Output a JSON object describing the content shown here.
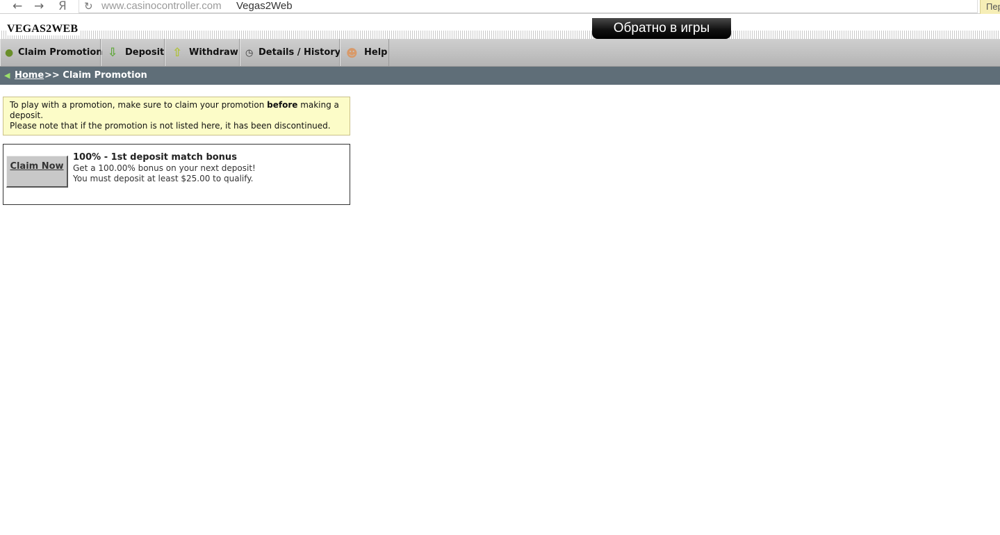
{
  "browser": {
    "back_icon": "←",
    "forward_icon": "→",
    "yandex_icon": "Я",
    "reload_icon": "↻",
    "url_domain": "www.casinocontroller.com",
    "url_title": "Vegas2Web",
    "translate_label": "Пер"
  },
  "header": {
    "logo": "VEGAS2WEB",
    "back_to_games": "Обратно в игры"
  },
  "menu": {
    "claim_promotion": "Claim Promotion",
    "deposit": "Deposit",
    "withdraw": "Withdraw",
    "details_history": "Details / History",
    "help": "Help",
    "icons": {
      "claim": "coin-icon",
      "deposit": "arrow-down-icon",
      "withdraw": "arrow-up-icon",
      "details": "clock-icon",
      "help": "person-icon"
    }
  },
  "breadcrumb": {
    "home": "Home",
    "current": ">> Claim Promotion"
  },
  "notice": {
    "line1_before": "To play with a promotion, make sure to claim your promotion ",
    "line1_bold": "before",
    "line1_after": " making a deposit.",
    "line2": "Please note that if the promotion is not listed here, it has been discontinued."
  },
  "promotion": {
    "claim_button": "Claim Now",
    "title": "100% - 1st deposit match bonus",
    "line1": "Get a 100.00% bonus on your next deposit!",
    "line2": "You must deposit at least $25.00 to qualify."
  },
  "colors": {
    "menu_bg": "#c2c2c2",
    "breadcrumb_bg": "#5f6e78",
    "notice_bg": "#fcfcc8",
    "button_bg": "#c8c8c8"
  }
}
